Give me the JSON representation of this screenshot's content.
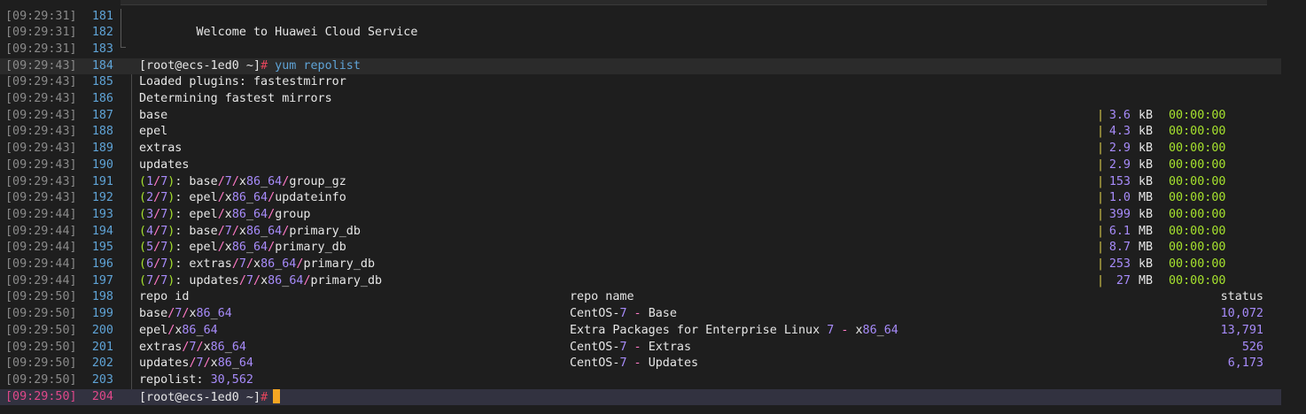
{
  "terminal": {
    "lines": [
      {
        "ts": "[09:29:31]",
        "n": "181",
        "text": ""
      },
      {
        "ts": "[09:29:31]",
        "n": "182",
        "text": "        Welcome to Huawei Cloud Service"
      },
      {
        "ts": "[09:29:31]",
        "n": "183",
        "text": ""
      },
      {
        "ts": "[09:29:43]",
        "n": "184",
        "prompt": "[root@ecs-1ed0 ~]",
        "hash": "#",
        "command": " yum repolist"
      },
      {
        "ts": "[09:29:43]",
        "n": "185",
        "text": "Loaded plugins",
        "after": " fastestmirror"
      },
      {
        "ts": "[09:29:43]",
        "n": "186",
        "text": "Determining fastest mirrors"
      },
      {
        "ts": "[09:29:43]",
        "n": "187",
        "text": "base",
        "bar": "|",
        "size": "3.6",
        "unit": "kB",
        "time": "00:00:00"
      },
      {
        "ts": "[09:29:43]",
        "n": "188",
        "text": "epel",
        "bar": "|",
        "size": "4.3",
        "unit": "kB",
        "time": "00:00:00"
      },
      {
        "ts": "[09:29:43]",
        "n": "189",
        "text": "extras",
        "bar": "|",
        "size": "2.9",
        "unit": "kB",
        "time": "00:00:00"
      },
      {
        "ts": "[09:29:43]",
        "n": "190",
        "text": "updates",
        "bar": "|",
        "size": "2.9",
        "unit": "kB",
        "time": "00:00:00"
      },
      {
        "ts": "[09:29:43]",
        "n": "191",
        "frac": "(1/7)",
        "path": ": base/7/x86_64/group_gz",
        "bar": "|",
        "size": "153",
        "unit": "kB",
        "time": "00:00:00"
      },
      {
        "ts": "[09:29:43]",
        "n": "192",
        "frac": "(2/7)",
        "path": ": epel/x86_64/updateinfo",
        "bar": "|",
        "size": "1.0",
        "unit": "MB",
        "time": "00:00:00"
      },
      {
        "ts": "[09:29:44]",
        "n": "193",
        "frac": "(3/7)",
        "path": ": epel/x86_64/group",
        "bar": "|",
        "size": "399",
        "unit": "kB",
        "time": "00:00:00"
      },
      {
        "ts": "[09:29:44]",
        "n": "194",
        "frac": "(4/7)",
        "path": ": base/7/x86_64/primary_db",
        "bar": "|",
        "size": "6.1",
        "unit": "MB",
        "time": "00:00:00"
      },
      {
        "ts": "[09:29:44]",
        "n": "195",
        "frac": "(5/7)",
        "path": ": epel/x86_64/primary_db",
        "bar": "|",
        "size": "8.7",
        "unit": "MB",
        "time": "00:00:00"
      },
      {
        "ts": "[09:29:44]",
        "n": "196",
        "frac": "(6/7)",
        "path": ": extras/7/x86_64/primary_db",
        "bar": "|",
        "size": "253",
        "unit": "kB",
        "time": "00:00:00"
      },
      {
        "ts": "[09:29:44]",
        "n": "197",
        "frac": "(7/7)",
        "path": ": updates/7/x86_64/primary_db",
        "bar": "|",
        "size": "27",
        "unit": "MB",
        "time": "00:00:00"
      },
      {
        "ts": "[09:29:50]",
        "n": "198",
        "text": "repo id",
        "name": "repo name",
        "status": "status"
      },
      {
        "ts": "[09:29:50]",
        "n": "199",
        "text": "base/7/x86_64",
        "name": "CentOS-7 - Base",
        "status": "10,072"
      },
      {
        "ts": "[09:29:50]",
        "n": "200",
        "text": "epel/x86_64",
        "name": "Extra Packages for Enterprise Linux 7 - x86_64",
        "status": "13,791"
      },
      {
        "ts": "[09:29:50]",
        "n": "201",
        "text": "extras/7/x86_64",
        "name": "CentOS-7 - Extras",
        "status": "526"
      },
      {
        "ts": "[09:29:50]",
        "n": "202",
        "text": "updates/7/x86_64",
        "name": "CentOS-7 - Updates",
        "status": "6,173"
      },
      {
        "ts": "[09:29:50]",
        "n": "203",
        "text": "repolist: 30,562"
      },
      {
        "ts": "[09:29:50]",
        "n": "204",
        "prompt": "[root@ecs-1ed0 ~]",
        "hash": "#",
        "command": "",
        "cursor": true
      }
    ],
    "fold_icon": "collapse-icon",
    "cursor_color": "#f5a623"
  }
}
